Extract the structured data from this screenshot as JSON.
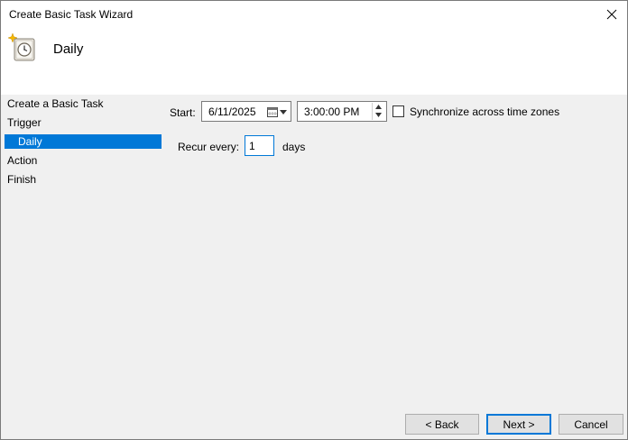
{
  "window": {
    "title": "Create Basic Task Wizard"
  },
  "header": {
    "title": "Daily",
    "icon": "task-scheduler-clock-icon"
  },
  "nav": {
    "items": [
      {
        "label": "Create a Basic Task",
        "selected": false
      },
      {
        "label": "Trigger",
        "selected": false
      },
      {
        "label": "Daily",
        "selected": true
      },
      {
        "label": "Action",
        "selected": false
      },
      {
        "label": "Finish",
        "selected": false
      }
    ]
  },
  "form": {
    "start_label": "Start:",
    "start_date": "6/11/2025",
    "start_time": "3:00:00 PM",
    "sync_label": "Synchronize across time zones",
    "sync_checked": false,
    "recur_label": "Recur every:",
    "recur_value": "1",
    "recur_unit": "days"
  },
  "buttons": {
    "back": "< Back",
    "next": "Next >",
    "cancel": "Cancel"
  },
  "colors": {
    "accent": "#0078d7",
    "background": "#f0f0f0",
    "header_bg": "#ffffff"
  }
}
